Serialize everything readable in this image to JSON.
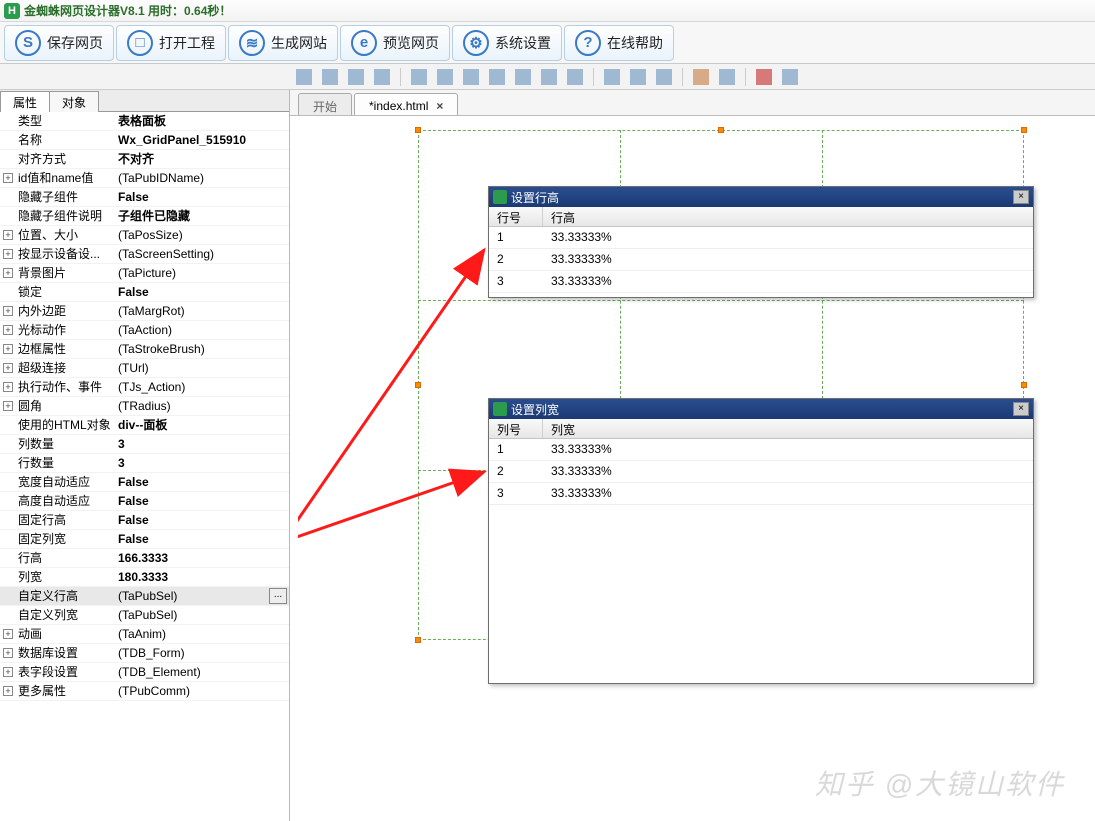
{
  "title": "金蜘蛛网页设计器V8.1 用时：0.64秒！",
  "toolbar": [
    {
      "icon": "save",
      "label": "保存网页"
    },
    {
      "icon": "open",
      "label": "打开工程"
    },
    {
      "icon": "build",
      "label": "生成网站"
    },
    {
      "icon": "preview",
      "label": "预览网页"
    },
    {
      "icon": "settings",
      "label": "系统设置"
    },
    {
      "icon": "help",
      "label": "在线帮助"
    }
  ],
  "left_tabs": {
    "a": "属性",
    "b": "对象"
  },
  "props": [
    {
      "k": "类型",
      "v": "表格面板",
      "b": 1
    },
    {
      "k": "名称",
      "v": "Wx_GridPanel_515910",
      "b": 1
    },
    {
      "k": "对齐方式",
      "v": "不对齐",
      "b": 1
    },
    {
      "k": "id值和name值",
      "v": "(TaPubIDName)",
      "e": 1
    },
    {
      "k": "隐藏子组件",
      "v": "False",
      "b": 1
    },
    {
      "k": "隐藏子组件说明",
      "v": "子组件已隐藏",
      "b": 1
    },
    {
      "k": "位置、大小",
      "v": "(TaPosSize)",
      "e": 1
    },
    {
      "k": "按显示设备设...",
      "v": "(TaScreenSetting)",
      "e": 1
    },
    {
      "k": "背景图片",
      "v": "(TaPicture)",
      "e": 1
    },
    {
      "k": "锁定",
      "v": "False",
      "b": 1
    },
    {
      "k": "内外边距",
      "v": "(TaMargRot)",
      "e": 1
    },
    {
      "k": "光标动作",
      "v": "(TaAction)",
      "e": 1
    },
    {
      "k": "边框属性",
      "v": "(TaStrokeBrush)",
      "e": 1
    },
    {
      "k": "超级连接",
      "v": "(TUrl)",
      "e": 1
    },
    {
      "k": "执行动作、事件",
      "v": "(TJs_Action)",
      "e": 1
    },
    {
      "k": "圆角",
      "v": "(TRadius)",
      "e": 1
    },
    {
      "k": "使用的HTML对象",
      "v": "div--面板",
      "b": 1
    },
    {
      "k": "列数量",
      "v": "3",
      "b": 1
    },
    {
      "k": "行数量",
      "v": "3",
      "b": 1
    },
    {
      "k": "宽度自动适应",
      "v": "False",
      "b": 1
    },
    {
      "k": "高度自动适应",
      "v": "False",
      "b": 1
    },
    {
      "k": "固定行高",
      "v": "False",
      "b": 1
    },
    {
      "k": "固定列宽",
      "v": "False",
      "b": 1
    },
    {
      "k": "行高",
      "v": "166.3333",
      "b": 1
    },
    {
      "k": "列宽",
      "v": "180.3333",
      "b": 1
    },
    {
      "k": "自定义行高",
      "v": "(TaPubSel)",
      "sel": 1
    },
    {
      "k": "自定义列宽",
      "v": "(TaPubSel)"
    },
    {
      "k": "动画",
      "v": "(TaAnim)",
      "e": 1
    },
    {
      "k": "数据库设置",
      "v": "(TDB_Form)",
      "e": 1
    },
    {
      "k": "表字段设置",
      "v": "(TDB_Element)",
      "e": 1
    },
    {
      "k": "更多属性",
      "v": "(TPubComm)",
      "e": 1
    }
  ],
  "doc_tabs": {
    "start": "开始",
    "file": "*index.html"
  },
  "dlg_row": {
    "title": "设置行高",
    "h1": "行号",
    "h2": "行高",
    "rows": [
      {
        "n": "1",
        "v": "33.33333%"
      },
      {
        "n": "2",
        "v": "33.33333%"
      },
      {
        "n": "3",
        "v": "33.33333%"
      }
    ]
  },
  "dlg_col": {
    "title": "设置列宽",
    "h1": "列号",
    "h2": "列宽",
    "rows": [
      {
        "n": "1",
        "v": "33.33333%"
      },
      {
        "n": "2",
        "v": "33.33333%"
      },
      {
        "n": "3",
        "v": "33.33333%"
      }
    ]
  },
  "watermark": "知乎 @大镜山软件",
  "ellipsis": "..."
}
